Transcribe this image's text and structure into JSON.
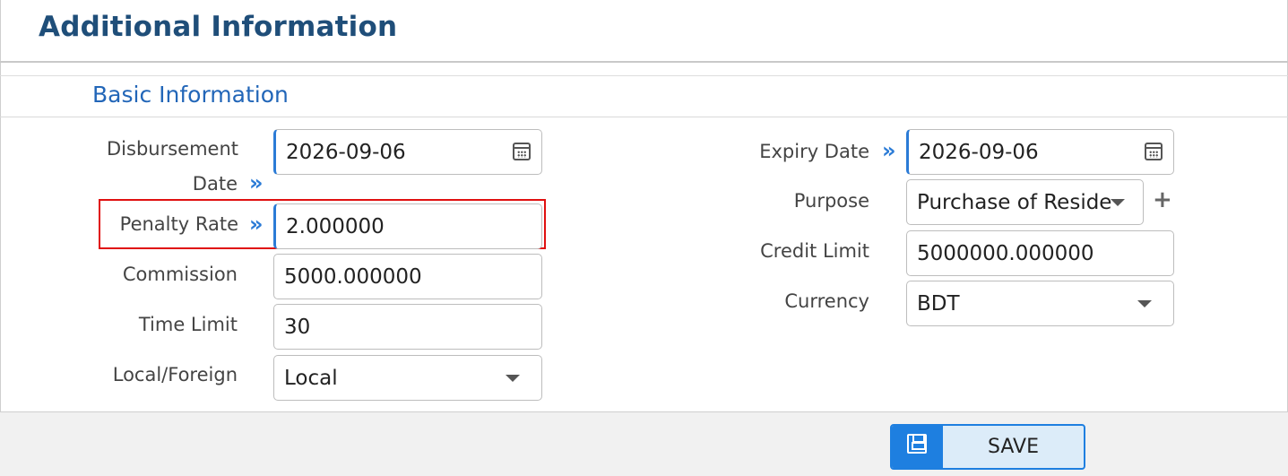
{
  "page": {
    "title": "Additional Information"
  },
  "section": {
    "title": "Basic Information"
  },
  "left_fields": {
    "disbursement_date": {
      "label_line1": "Disbursement",
      "label_line2": "Date",
      "value": "2026-09-06"
    },
    "penalty_rate": {
      "label": "Penalty Rate",
      "value": "2.000000"
    },
    "commission": {
      "label": "Commission",
      "value": "5000.000000"
    },
    "time_limit": {
      "label": "Time Limit",
      "value": "30"
    },
    "local_foreign": {
      "label": "Local/Foreign",
      "value": "Local"
    }
  },
  "right_fields": {
    "expiry_date": {
      "label": "Expiry Date",
      "value": "2026-09-06"
    },
    "purpose": {
      "label": "Purpose",
      "value": "Purchase of Reside"
    },
    "credit_limit": {
      "label": "Credit Limit",
      "value": "5000000.000000"
    },
    "currency": {
      "label": "Currency",
      "value": "BDT"
    }
  },
  "footer": {
    "save_label": "SAVE"
  },
  "icons": {
    "required_marker": "»",
    "add": "+"
  },
  "colors": {
    "title": "#1f4e79",
    "section": "#2266b8",
    "accent": "#2b7bd6",
    "highlight": "#e01010",
    "button": "#1e7fe0"
  }
}
